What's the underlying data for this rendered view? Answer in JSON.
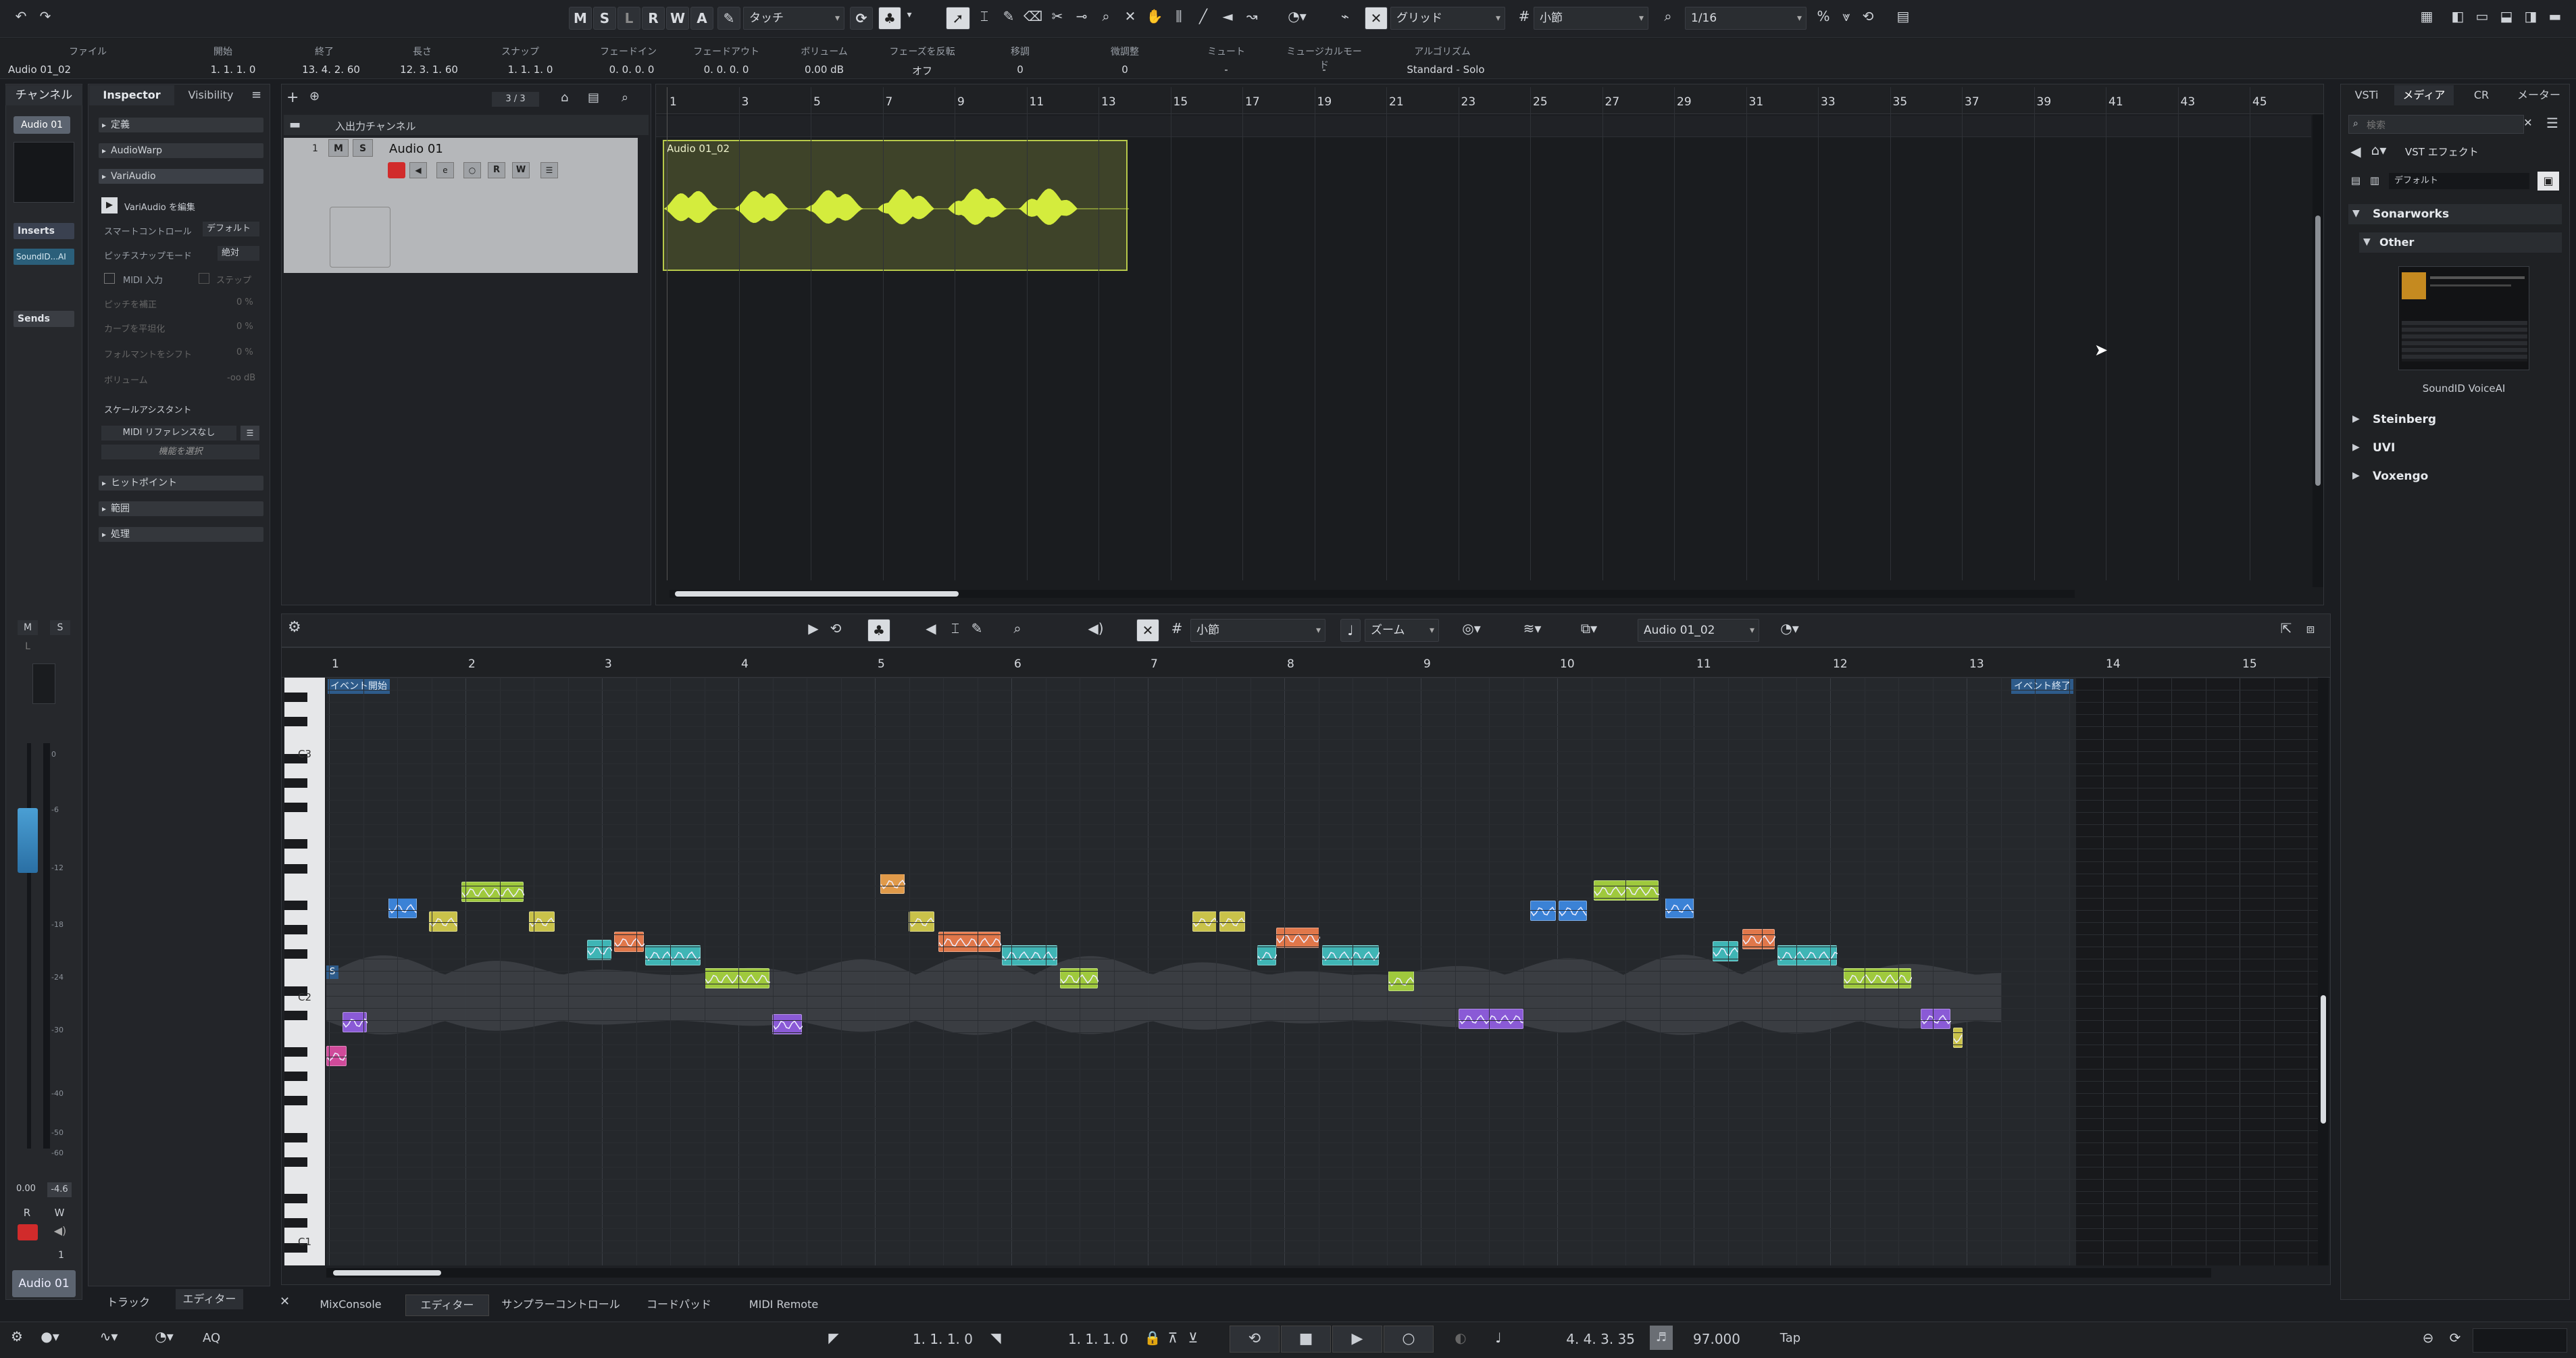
{
  "toolbar": {
    "undo_icon": "undo-icon",
    "redo_icon": "redo-icon",
    "mute_solo_buttons": [
      "M",
      "S",
      "L",
      "R",
      "W",
      "A"
    ],
    "automation_mode": "タッチ",
    "grid_type": "グリッド",
    "grid_value": "小節",
    "quantize_value": "1/16"
  },
  "infoline": {
    "event_name": "Audio 01_02",
    "fields": [
      {
        "label": "ファイル",
        "value": ""
      },
      {
        "label": "開始",
        "value": "1. 1. 1. 0"
      },
      {
        "label": "終了",
        "value": "13. 4. 2. 60"
      },
      {
        "label": "長さ",
        "value": "12. 3. 1. 60"
      },
      {
        "label": "スナップ",
        "value": "1. 1. 1. 0"
      },
      {
        "label": "フェードイン",
        "value": "0. 0. 0. 0"
      },
      {
        "label": "フェードアウト",
        "value": "0. 0. 0. 0"
      },
      {
        "label": "ボリューム",
        "value": "0.00 dB"
      },
      {
        "label": "フェーズを反転",
        "value": "オフ"
      },
      {
        "label": "移調",
        "value": "0"
      },
      {
        "label": "微調整",
        "value": "0"
      },
      {
        "label": "ミュート",
        "value": "-"
      },
      {
        "label": "ミュージカルモード",
        "value": "-"
      },
      {
        "label": "アルゴリズム",
        "value": "Standard - Solo"
      }
    ]
  },
  "left_strip": {
    "header": "チャンネル",
    "track_name": "Audio 01",
    "inserts_label": "Inserts",
    "insert_slot": "SoundID...AI",
    "sends_label": "Sends",
    "m": "M",
    "s": "S",
    "l": "L",
    "value_left": "0.00",
    "value_right": "-4.6",
    "r": "R",
    "w": "W",
    "channel_number": "1",
    "name_bottom": "Audio 01",
    "meter_scale": [
      "0",
      "-6",
      "-12",
      "-18",
      "-24",
      "-30",
      "-40",
      "-50",
      "-60"
    ]
  },
  "inspector": {
    "tabs": [
      "Inspector",
      "Visibility"
    ],
    "sections": [
      "定義",
      "AudioWarp",
      "VariAudio"
    ],
    "variaudio_edit": "VariAudio を編集",
    "smart_control_label": "スマートコントロール",
    "smart_control_value": "デフォルト",
    "pitch_snap_label": "ピッチスナップモード",
    "pitch_snap_value": "絶対",
    "midi_input": "MIDI 入力",
    "step": "ステップ",
    "sliders": [
      {
        "label": "ピッチを補正",
        "value": "0 %"
      },
      {
        "label": "カーブを平坦化",
        "value": "0 %"
      },
      {
        "label": "フォルマントをシフト",
        "value": "0 %"
      },
      {
        "label": "ボリューム",
        "value": "-oo dB"
      }
    ],
    "scale_assistant": "スケールアシスタント",
    "midi_ref": "MIDI リファレンスなし",
    "func_select": "機能を選択",
    "lower_sections": [
      "ヒットポイント",
      "範囲",
      "処理"
    ]
  },
  "bottom_left_tabs": [
    "トラック",
    "エディター"
  ],
  "tracklist": {
    "folder_name": "入出力チャンネル",
    "counter": "3 / 3",
    "track_number": "1",
    "track_name": "Audio 01",
    "m": "M",
    "s": "S",
    "rw": [
      "R",
      "W"
    ]
  },
  "arranger": {
    "ruler": [
      "1",
      "3",
      "5",
      "7",
      "9",
      "11",
      "13",
      "15",
      "17",
      "19",
      "21",
      "23",
      "25",
      "27",
      "29",
      "31",
      "33",
      "35",
      "37",
      "39",
      "41",
      "43",
      "45"
    ],
    "event_name": "Audio 01_02"
  },
  "editor": {
    "grid_value": "小節",
    "zoom_label": "ズーム",
    "event_select": "Audio 01_02",
    "ruler": [
      "1",
      "2",
      "3",
      "4",
      "5",
      "6",
      "7",
      "8",
      "9",
      "10",
      "11",
      "12",
      "13",
      "14",
      "15"
    ],
    "event_start": "イベント開始",
    "event_end": "イベント終了",
    "keys": [
      "C3",
      "C2",
      "C1"
    ],
    "s_marker": "S"
  },
  "bottom_tabs": [
    "MixConsole",
    "エディター",
    "サンプラーコントロール",
    "コードパッド",
    "MIDI Remote"
  ],
  "transport": {
    "aq": "AQ",
    "left_locator": "1. 1. 1. 0",
    "right_locator": "1. 1. 1. 0",
    "position": "4. 4. 3. 35",
    "tempo": "97.000",
    "tap": "Tap"
  },
  "right_zone": {
    "tabs": [
      "VSTi",
      "メディア",
      "CR",
      "メーター"
    ],
    "search_placeholder": "検索",
    "breadcrumb": "VST エフェクト",
    "preset": "デフォルト",
    "tree": [
      {
        "label": "Sonarworks",
        "expanded": true
      },
      {
        "label": "Other",
        "expanded": true
      },
      {
        "label": "Steinberg",
        "expanded": false
      },
      {
        "label": "UVI",
        "expanded": false
      },
      {
        "label": "Voxengo",
        "expanded": false
      }
    ],
    "plugin_name": "SoundID VoiceAI"
  }
}
